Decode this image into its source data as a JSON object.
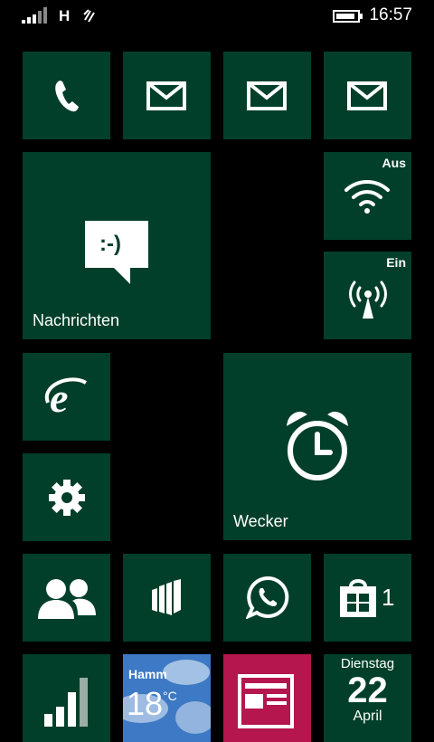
{
  "status": {
    "network": "H",
    "time": "16:57"
  },
  "tiles": {
    "phone": {
      "icon": "phone-icon"
    },
    "mail1": {
      "icon": "mail-icon"
    },
    "mail2": {
      "icon": "mail-icon"
    },
    "mail3": {
      "icon": "mail-icon"
    },
    "messaging": {
      "label": "Nachrichten",
      "icon": "chat-bubble-icon",
      "emoticon": ":-)"
    },
    "wifi": {
      "state": "Aus",
      "icon": "wifi-icon"
    },
    "hotspot": {
      "state": "Ein",
      "icon": "hotspot-icon"
    },
    "browser": {
      "icon": "internet-explorer-icon"
    },
    "settings": {
      "icon": "gear-icon"
    },
    "alarms": {
      "label": "Wecker",
      "icon": "alarm-clock-icon"
    },
    "people": {
      "icon": "people-icon"
    },
    "office": {
      "icon": "office-icon"
    },
    "whatsapp": {
      "icon": "whatsapp-icon"
    },
    "store": {
      "icon": "store-icon",
      "count": "1"
    },
    "signal": {
      "icon": "signal-bars-icon"
    },
    "weather": {
      "city": "Hamm",
      "temp": "18",
      "unit": "°C"
    },
    "news": {
      "icon": "news-icon"
    },
    "calendar": {
      "day": "Dienstag",
      "date": "22",
      "month": "April"
    }
  },
  "colors": {
    "tile": "#013f2a",
    "news": "#b5164e",
    "weather": "#3d79c4"
  }
}
